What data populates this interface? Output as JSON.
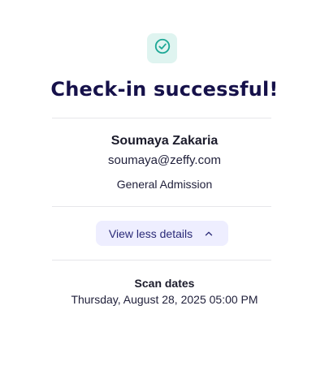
{
  "header": {
    "icon": "check-circle-icon",
    "title": "Check-in successful!"
  },
  "attendee": {
    "name": "Soumaya Zakaria",
    "email": "soumaya@zeffy.com",
    "ticket": "General Admission"
  },
  "details_toggle": {
    "label": "View less details",
    "icon": "chevron-up-icon"
  },
  "scan": {
    "title": "Scan dates",
    "date": "Thursday, August 28, 2025 05:00 PM"
  },
  "colors": {
    "title": "#16114a",
    "accent": "#1ea896",
    "icon_bg": "#dff4f0",
    "button_bg": "#eeeeff",
    "button_text": "#2a2a77",
    "divider": "#e6e6ea"
  }
}
